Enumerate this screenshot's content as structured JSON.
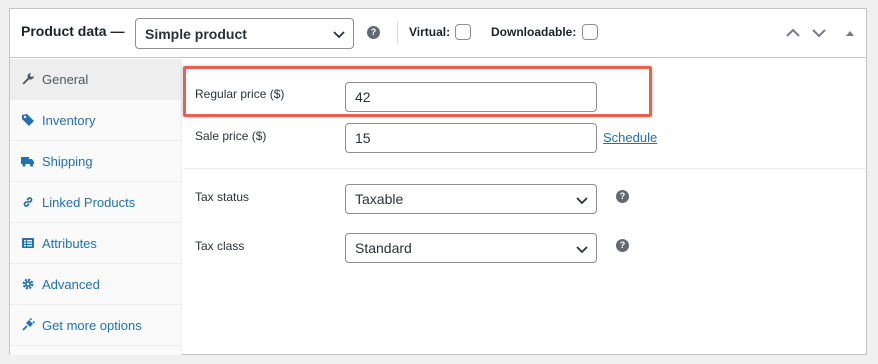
{
  "header": {
    "title": "Product data —",
    "product_type": "Simple product",
    "help_glyph": "?",
    "virtual_label": "Virtual:",
    "downloadable_label": "Downloadable:"
  },
  "tabs": [
    {
      "label": "General",
      "icon": "wrench-icon",
      "active": true
    },
    {
      "label": "Inventory",
      "icon": "tag-icon",
      "active": false
    },
    {
      "label": "Shipping",
      "icon": "truck-icon",
      "active": false
    },
    {
      "label": "Linked Products",
      "icon": "link-icon",
      "active": false
    },
    {
      "label": "Attributes",
      "icon": "list-icon",
      "active": false
    },
    {
      "label": "Advanced",
      "icon": "gear-icon",
      "active": false
    },
    {
      "label": "Get more options",
      "icon": "plug-icon",
      "active": false
    }
  ],
  "general": {
    "regular_price_label": "Regular price ($)",
    "regular_price_value": "42",
    "sale_price_label": "Sale price ($)",
    "sale_price_value": "15",
    "schedule_link": "Schedule",
    "tax_status_label": "Tax status",
    "tax_status_value": "Taxable",
    "tax_class_label": "Tax class",
    "tax_class_value": "Standard"
  },
  "colors": {
    "link": "#2271b1",
    "highlight": "#e8604f",
    "border": "#c3c4c7"
  }
}
